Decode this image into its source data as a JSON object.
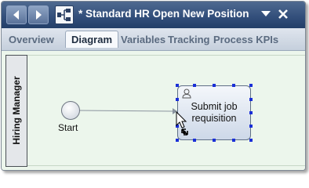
{
  "window": {
    "title": "* Standard HR Open New Position"
  },
  "tabs": [
    {
      "label": "Overview",
      "active": false
    },
    {
      "label": "Diagram",
      "active": true
    },
    {
      "label": "Variables",
      "active": false
    },
    {
      "label": "Tracking",
      "active": false
    },
    {
      "label": "Process KPIs",
      "active": false
    }
  ],
  "diagram": {
    "lane_label": "Hiring Manager",
    "start_event_label": "Start",
    "task": {
      "label_line1": "Submit job",
      "label_line2": "requisition"
    }
  },
  "colors": {
    "titlebar": "#34507c",
    "canvas_background": "#ecf6ec",
    "selection_handle": "#1a2fd8"
  },
  "icons": {
    "back": "chevron-left-icon",
    "forward": "chevron-right-icon",
    "process": "process-editor-icon",
    "menu": "dropdown-arrow-icon",
    "close": "close-icon",
    "task_type": "human-task-icon"
  }
}
